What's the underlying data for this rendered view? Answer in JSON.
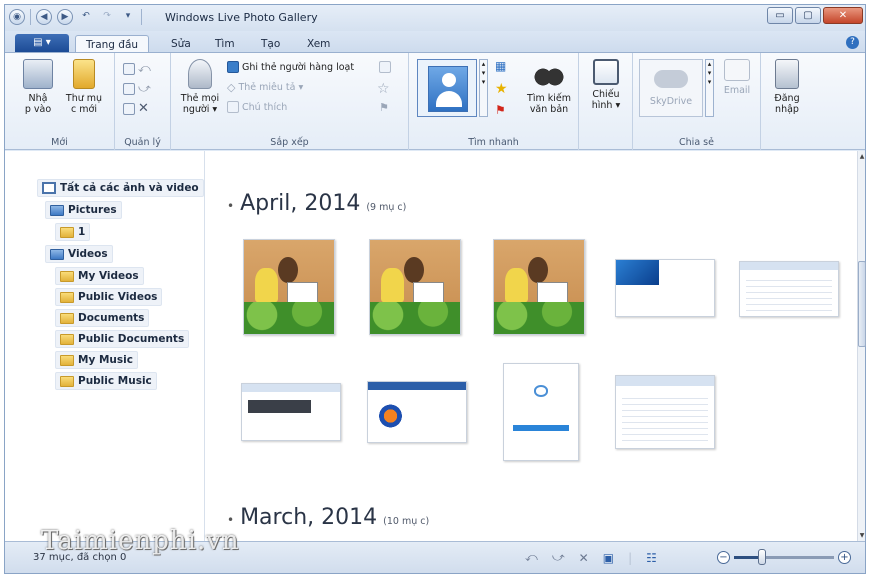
{
  "window": {
    "title": "Windows Live Photo Gallery",
    "min_label": "▭",
    "max_label": "▢",
    "close_label": "✕"
  },
  "qat": {
    "menu_arrow": "▾"
  },
  "file_button": {
    "label": "▤ ▾"
  },
  "tabs": [
    {
      "label": "Trang đầu",
      "active": true
    },
    {
      "label": "Sửa"
    },
    {
      "label": "Tìm"
    },
    {
      "label": "Tạo"
    },
    {
      "label": "Xem"
    }
  ],
  "ribbon": {
    "groups": {
      "moi": {
        "label": "Mới",
        "import_label": "Nhậ\np vào",
        "folder_label": "Thư mụ\nc mới"
      },
      "quanly": {
        "label": "Quản lý"
      },
      "sapxep": {
        "label": "Sắp xếp",
        "tag_people_label": "Thẻ mọi\nngười ▾",
        "batch_tag_label": "Ghi thẻ người hàng loạt",
        "describe_tag_label": "Thẻ miêu tả ▾",
        "caption_label": "Chú thích"
      },
      "timnhanh": {
        "label": "Tìm nhanh",
        "find_label": "Tìm kiếm\nvăn bản"
      },
      "chieuhinh": {
        "label": "Chiếu\nhình ▾"
      },
      "chiase": {
        "label": "Chia sẻ",
        "skydrive_label": "SkyDrive",
        "email_label": "Email"
      },
      "dangnhap": {
        "label": "Đăng\nnhập"
      }
    }
  },
  "sidebar": {
    "items": [
      {
        "label": "Tất cả các ảnh và video"
      },
      {
        "label": "Pictures"
      },
      {
        "label": "1"
      },
      {
        "label": "Videos"
      },
      {
        "label": "My Videos"
      },
      {
        "label": "Public Videos"
      },
      {
        "label": "Documents"
      },
      {
        "label": "Public Documents"
      },
      {
        "label": "My Music"
      },
      {
        "label": "Public Music"
      }
    ]
  },
  "main": {
    "groups": [
      {
        "title": "April, 2014",
        "count": "(9 mụ c)"
      },
      {
        "title": "March, 2014",
        "count": "(10 mụ c)"
      }
    ],
    "bullet": "•"
  },
  "status": {
    "text": "37 mục, đã chọn 0",
    "watermark": "Taimienphi.vn",
    "zoom_minus": "−",
    "zoom_plus": "+",
    "zoom_level": 0.28
  }
}
